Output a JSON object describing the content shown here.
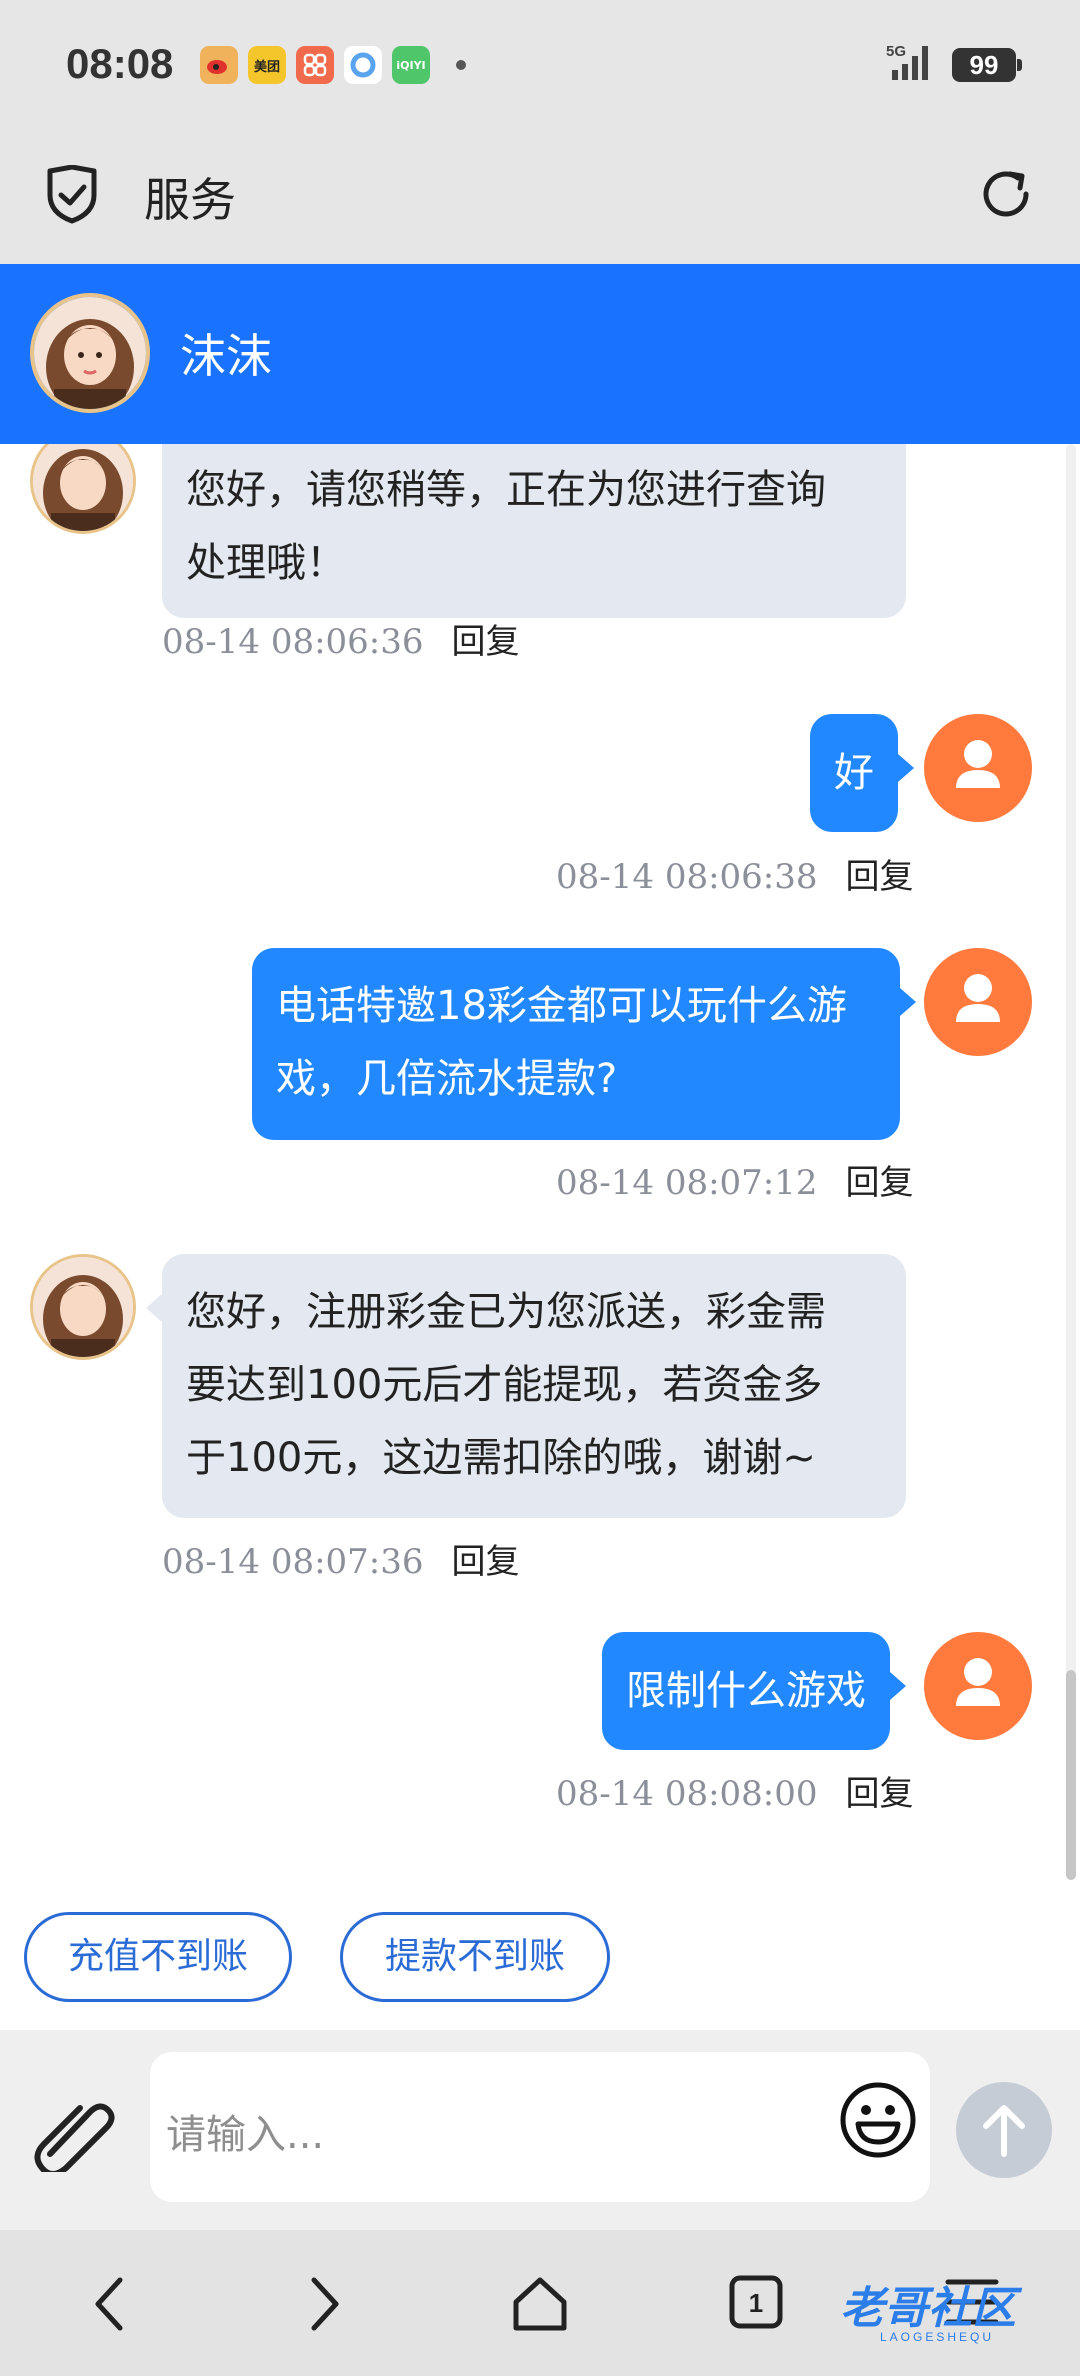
{
  "status": {
    "time": "08:08",
    "apps": [
      {
        "icon": "weibo-icon",
        "label": "",
        "color": "#f0b25a"
      },
      {
        "icon": "meituan-icon",
        "label": "美团",
        "color": "#f5c62c"
      },
      {
        "icon": "app-icon",
        "label": "",
        "color": "#f16a4b"
      },
      {
        "icon": "browser-icon",
        "label": "",
        "color": "#5aa3ef"
      },
      {
        "icon": "iqiyi-icon",
        "label": "iQIYI",
        "color": "#4fc66a"
      }
    ],
    "network": "5G",
    "battery": "99"
  },
  "header": {
    "title": "服务"
  },
  "agent": {
    "name": "沫沫"
  },
  "messages": [
    {
      "side": "agent",
      "lines": [
        "您好，请您稍等，正在为您进行查询",
        "处理哦！"
      ],
      "time": "08-14 08:06:36",
      "reply": "回复"
    },
    {
      "side": "me",
      "lines": [
        "好"
      ],
      "time": "08-14 08:06:38",
      "reply": "回复"
    },
    {
      "side": "me",
      "lines": [
        "电话特邀18彩金都可以玩什么游",
        "戏，几倍流水提款?"
      ],
      "time": "08-14 08:07:12",
      "reply": "回复"
    },
    {
      "side": "agent",
      "lines": [
        "您好，注册彩金已为您派送，彩金需",
        "要达到100元后才能提现，若资金多",
        "于100元，这边需扣除的哦，谢谢~"
      ],
      "time": "08-14 08:07:36",
      "reply": "回复"
    },
    {
      "side": "me",
      "lines": [
        "限制什么游戏"
      ],
      "time": "08-14 08:08:00",
      "reply": "回复"
    }
  ],
  "quick_buttons": [
    "充值不到账",
    "提款不到账"
  ],
  "input": {
    "placeholder": "请输入..."
  },
  "watermark": {
    "text": "老哥社区",
    "sub": "LAOGESHEQU"
  },
  "colors": {
    "accent": "#1a73ff",
    "bubble_me": "#2288ff",
    "bubble_agent": "#e4e9f1",
    "user_avatar": "#ff7a3c"
  }
}
